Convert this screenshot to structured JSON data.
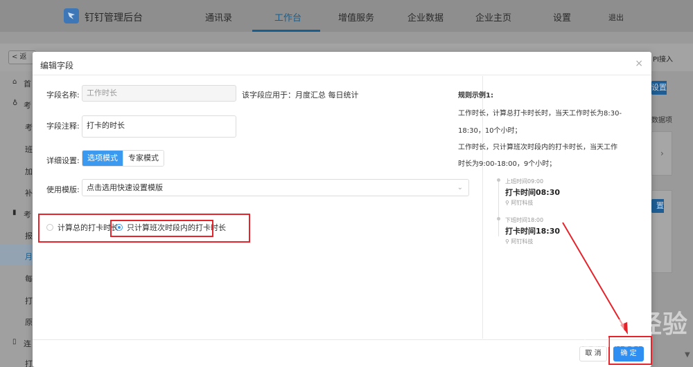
{
  "header": {
    "app_title": "钉钉管理后台",
    "nav": [
      "通讯录",
      "工作台",
      "增值服务",
      "企业数据",
      "企业主页",
      "设置"
    ],
    "active_nav": "工作台",
    "logout": "退出"
  },
  "subbar": {
    "back": "< 返",
    "api": "PI接入"
  },
  "sidebar": {
    "items": [
      "首",
      "考",
      "考",
      "班",
      "加",
      "补",
      "考",
      "报",
      "月",
      "每",
      "打",
      "原",
      "连",
      "打"
    ]
  },
  "right_partial": {
    "btn1": "设置",
    "text": "数据项",
    "btn2": "置",
    "chevron": "›"
  },
  "modal": {
    "title": "编辑字段",
    "close": "×",
    "field_name_label": "字段名称:",
    "field_name_value": "工作时长",
    "applies_to": "该字段应用于：月度汇总 每日统计",
    "note_label": "字段注释:",
    "note_value": "打卡的时长",
    "detail_label": "详细设置:",
    "mode_option": "选项模式",
    "mode_expert": "专家模式",
    "template_label": "使用模版:",
    "template_placeholder": "点击选用快速设置模版",
    "radio_total": "计算总的打卡时长",
    "radio_shift": "只计算班次时段内的打卡时长",
    "example": {
      "title": "规则示例1:",
      "lines": [
        "工作时长，计算总打卡时长时，当天工作时长为8:30-",
        "18:30，10个小时；",
        "工作时长，只计算班次时段内的打卡时长，当天工作",
        "时长为9:00-18:00，9个小时；"
      ],
      "timeline": [
        {
          "small": "上班时间09:00",
          "big": "打卡时间08:30",
          "loc": "阿钉科技"
        },
        {
          "small": "下班时间18:00",
          "big": "打卡时间18:30",
          "loc": "阿钉科技"
        }
      ]
    },
    "cancel": "取 消",
    "confirm": "确 定"
  },
  "watermark": {
    "main": "Bai du 经验",
    "sub": "jingyan.baidu.com"
  },
  "colors": {
    "primary": "#2f8ef1",
    "annotation": "#e5232b"
  }
}
